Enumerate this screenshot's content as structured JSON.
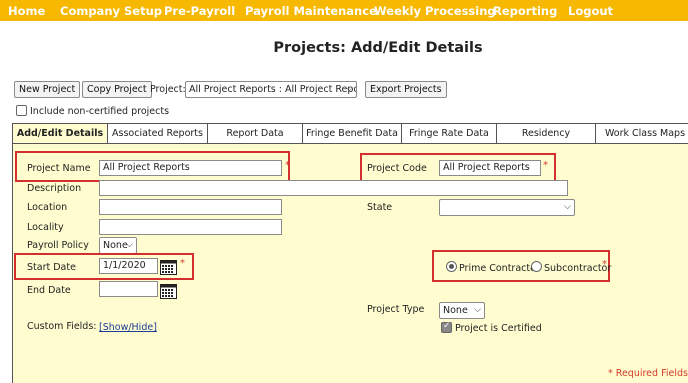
{
  "nav": {
    "items": [
      "Home",
      "Company Setup",
      "Pre-Payroll",
      "Payroll Maintenance",
      "Weekly Processing",
      "Reporting",
      "Logout"
    ]
  },
  "page_title": "Projects: Add/Edit Details",
  "toolbar": {
    "new_project": "New Project",
    "copy_project": "Copy Project",
    "project_label": "Project:",
    "project_select": "All Project Reports : All Project Reports",
    "export_projects": "Export Projects",
    "include_noncertified": "Include non-certified projects"
  },
  "tabs": [
    "Add/Edit Details",
    "Associated Reports",
    "Report Data",
    "Fringe Benefit Data",
    "Fringe Rate Data",
    "Residency",
    "Work Class Maps"
  ],
  "form": {
    "project_name_label": "Project Name",
    "project_name_value": "All Project Reports",
    "project_code_label": "Project Code",
    "project_code_value": "All Project Reports",
    "description_label": "Description",
    "location_label": "Location",
    "state_label": "State",
    "locality_label": "Locality",
    "payroll_policy_label": "Payroll Policy",
    "payroll_policy_value": "None",
    "start_date_label": "Start Date",
    "start_date_value": "1/1/2020",
    "end_date_label": "End Date",
    "prime_contractor": "Prime Contractor",
    "subcontractor": "Subcontractor",
    "project_type_label": "Project Type",
    "project_type_value": "None",
    "custom_fields_label": "Custom Fields:",
    "show_hide": "[Show/Hide]",
    "is_certified": "Project is Certified",
    "required_star": "*",
    "required_note": "* Required Fields"
  },
  "colors": {
    "nav": "#f6b800",
    "panel": "#fffdd0",
    "highlight": "#d32f2f",
    "required": "#d43a2a"
  }
}
